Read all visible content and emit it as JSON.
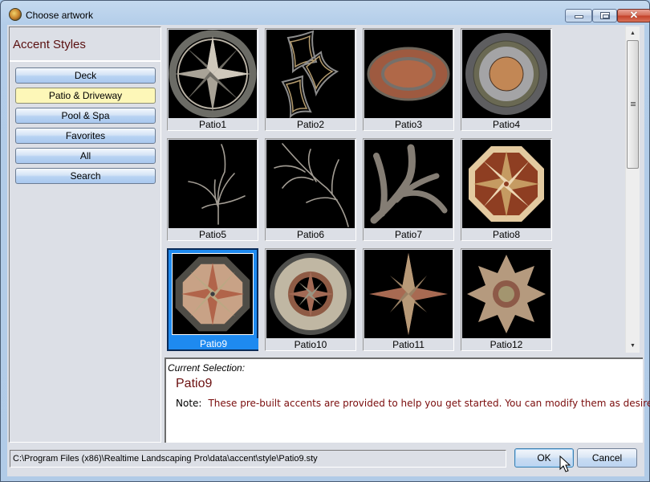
{
  "window": {
    "title": "Choose artwork",
    "icon": "app-globe-icon",
    "controls": {
      "minimize": "minimize-icon",
      "maximize": "maximize-icon",
      "close": "close-icon",
      "close_glyph": "✕"
    }
  },
  "sidebar": {
    "title": "Accent Styles",
    "categories": [
      {
        "label": "Deck",
        "active": false
      },
      {
        "label": "Patio & Driveway",
        "active": true
      },
      {
        "label": "Pool & Spa",
        "active": false
      },
      {
        "label": "Favorites",
        "active": false
      },
      {
        "label": "All",
        "active": false
      },
      {
        "label": "Search",
        "active": false
      }
    ]
  },
  "gallery": {
    "items": [
      {
        "label": "Patio1",
        "art": "compass-star"
      },
      {
        "label": "Patio2",
        "art": "curved-diamonds"
      },
      {
        "label": "Patio3",
        "art": "brick-oval"
      },
      {
        "label": "Patio4",
        "art": "concentric-rings"
      },
      {
        "label": "Patio5",
        "art": "branch-lines"
      },
      {
        "label": "Patio6",
        "art": "fern-lines"
      },
      {
        "label": "Patio7",
        "art": "stone-branches"
      },
      {
        "label": "Patio8",
        "art": "wood-octagon"
      },
      {
        "label": "Patio9",
        "art": "stone-octagon-star"
      },
      {
        "label": "Patio10",
        "art": "gravel-compass"
      },
      {
        "label": "Patio11",
        "art": "brick-compass-star"
      },
      {
        "label": "Patio12",
        "art": "eight-point-star"
      }
    ],
    "selected_index": 8,
    "scrollbar": {
      "up_glyph": "▲",
      "down_glyph": "▼"
    }
  },
  "selection": {
    "label": "Current Selection:",
    "name": "Patio9",
    "note_key": "Note:",
    "note_text": "These pre-built accents are provided to help you get started. You can modify them as desired."
  },
  "footer": {
    "path": "C:\\Program Files (x86)\\Realtime Landscaping Pro\\data\\accent\\style\\Patio9.sty",
    "ok_label": "OK",
    "cancel_label": "Cancel"
  },
  "colors": {
    "selection": "#1e8af0",
    "active_category": "#fdf7b8",
    "title_red": "#6b1010"
  }
}
